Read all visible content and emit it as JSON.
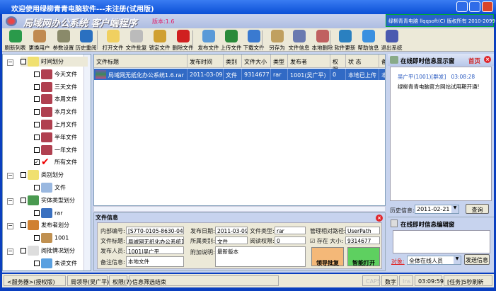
{
  "window": {
    "title": "欢迎使用绿柳青青电脑软件---未注册(试用版)"
  },
  "banner": {
    "title": "局域网办公系统 客户端程序",
    "version": "版本:1.6",
    "copyright": "绿柳青青电脑 llqqsoft(C) 版权所有 2010-2099"
  },
  "toolbar": [
    {
      "label": "刷新列表",
      "icon": "refresh-icon",
      "color": "#2a9a4a"
    },
    {
      "label": "更换用户",
      "icon": "users-icon",
      "color": "#c08a50"
    },
    {
      "label": "参数设置",
      "icon": "settings-icon",
      "color": "#8a8a6a"
    },
    {
      "label": "历史重阅",
      "icon": "globe-icon",
      "color": "#2a70c0"
    },
    {
      "label": "打开文件",
      "icon": "folder-open-icon",
      "color": "#f0d060"
    },
    {
      "label": "文件批复",
      "icon": "edit-icon",
      "color": "#bbb"
    },
    {
      "label": "锁定文件",
      "icon": "lock-icon",
      "color": "#d0a030"
    },
    {
      "label": "删除文件",
      "icon": "delete-icon",
      "color": "#d02020"
    },
    {
      "label": "发布文件",
      "icon": "publish-icon",
      "color": "#5a9ad8"
    },
    {
      "label": "上传文件",
      "icon": "upload-icon",
      "color": "#2a8a3a"
    },
    {
      "label": "下载文件",
      "icon": "download-icon",
      "color": "#3a7ad0"
    },
    {
      "label": "另存为",
      "icon": "save-as-icon",
      "color": "#c0a060"
    },
    {
      "label": "文件信息",
      "icon": "file-info-icon",
      "color": "#6a7ab0"
    },
    {
      "label": "本地删除",
      "icon": "local-delete-icon",
      "color": "#c06060"
    },
    {
      "label": "软件更新",
      "icon": "update-icon",
      "color": "#2a80c0"
    },
    {
      "label": "帮助信息",
      "icon": "help-icon",
      "color": "#3a90e0"
    },
    {
      "label": "退出系统",
      "icon": "exit-icon",
      "color": "#4a5ab0"
    }
  ],
  "tree": [
    {
      "label": "时间划分",
      "level": 0,
      "expanded": true,
      "checked": false,
      "icon": "folder-icon"
    },
    {
      "label": "今天文件",
      "level": 1,
      "checked": false,
      "icon": "calendar-icon"
    },
    {
      "label": "三天文件",
      "level": 1,
      "checked": false,
      "icon": "calendar-icon"
    },
    {
      "label": "本周文件",
      "level": 1,
      "checked": false,
      "icon": "calendar-icon"
    },
    {
      "label": "本月文件",
      "level": 1,
      "checked": false,
      "icon": "calendar-icon"
    },
    {
      "label": "上月文件",
      "level": 1,
      "checked": false,
      "icon": "calendar-icon"
    },
    {
      "label": "半年文件",
      "level": 1,
      "checked": false,
      "icon": "calendar-icon"
    },
    {
      "label": "一年文件",
      "level": 1,
      "checked": false,
      "icon": "calendar-icon"
    },
    {
      "label": "所有文件",
      "level": 1,
      "checked": true,
      "icon": "checkmark-icon"
    },
    {
      "label": "类别划分",
      "level": 0,
      "expanded": true,
      "checked": false,
      "icon": "folder-icon"
    },
    {
      "label": "文件",
      "level": 1,
      "checked": false,
      "icon": "category-icon"
    },
    {
      "label": "实体类型划分",
      "level": 0,
      "expanded": true,
      "checked": false,
      "icon": "map-icon"
    },
    {
      "label": "rar",
      "level": 1,
      "checked": false,
      "icon": "file-type-icon"
    },
    {
      "label": "发布者划分",
      "level": 0,
      "expanded": true,
      "checked": false,
      "icon": "users-icon"
    },
    {
      "label": "1001",
      "level": 1,
      "checked": false,
      "icon": "user-icon"
    },
    {
      "label": "阅批情况划分",
      "level": 0,
      "expanded": true,
      "checked": false,
      "icon": "document-icon"
    },
    {
      "label": "未读文件",
      "level": 1,
      "checked": false,
      "icon": "computer-icon"
    }
  ],
  "table": {
    "columns": [
      "文件标题",
      "发布时间",
      "类别",
      "文件大小",
      "类型",
      "发布者",
      "权限",
      "状 态",
      "备"
    ],
    "rows": [
      [
        "局域网无纸化办公系统1.6.rar",
        "2011-03-09",
        "文件",
        "9314677",
        "rar",
        "1001(吴广平)",
        "0",
        "本地已上传",
        "本"
      ]
    ]
  },
  "file_info": {
    "title": "文件信息",
    "internal_id_label": "内部编号:",
    "internal_id": "[S7T0-0105-8630-0400-359",
    "file_title_label": "文件标题:",
    "file_title": "局域网无纸化办公系统1.6",
    "publisher_label": "发布人员:",
    "publisher": "1001|吴广平",
    "remark_label": "备注信息:",
    "remark": "本地文件",
    "pub_date_label": "发布日期:",
    "pub_date": "2011-03-09",
    "category_label": "所属类别:",
    "category": "文件",
    "note_label": "附加说明:",
    "note": "最新版本",
    "file_type_label": "文件类型:",
    "file_type": "rar",
    "read_perm_label": "阅读权限:",
    "read_perm": "0",
    "path_label": "管理相对路径:",
    "path": "UserPath",
    "exists_label": "存在",
    "exists": true,
    "size_label": "大小:",
    "size": "9314677",
    "leader_btn": "领导批复",
    "smart_open_btn": "智能打开"
  },
  "chat": {
    "display_title": "在线即时信息显示窗",
    "home_link": "首页",
    "messages": [
      {
        "sender": "吴广平(1001)[群发]",
        "time": "03:08:28",
        "text": "绿柳青青电脑官方网站试用期开通!"
      }
    ],
    "history_label": "历史信息:",
    "history_date": "2011-02-21",
    "query_btn": "查询",
    "editor_title": "在线即时信息编辑窗",
    "target_label": "对象:",
    "target": "全体在线人员",
    "send_btn": "发送信息"
  },
  "status": {
    "server": "<服务器>(授权版)",
    "user": "局领导(吴广平)",
    "perm": "权限(7)",
    "message": "信息筛选结束",
    "caps": "CAPS",
    "num": "数字",
    "ins": "Ins",
    "time": "03:09:59",
    "task": "[任务]5秒刷新"
  }
}
